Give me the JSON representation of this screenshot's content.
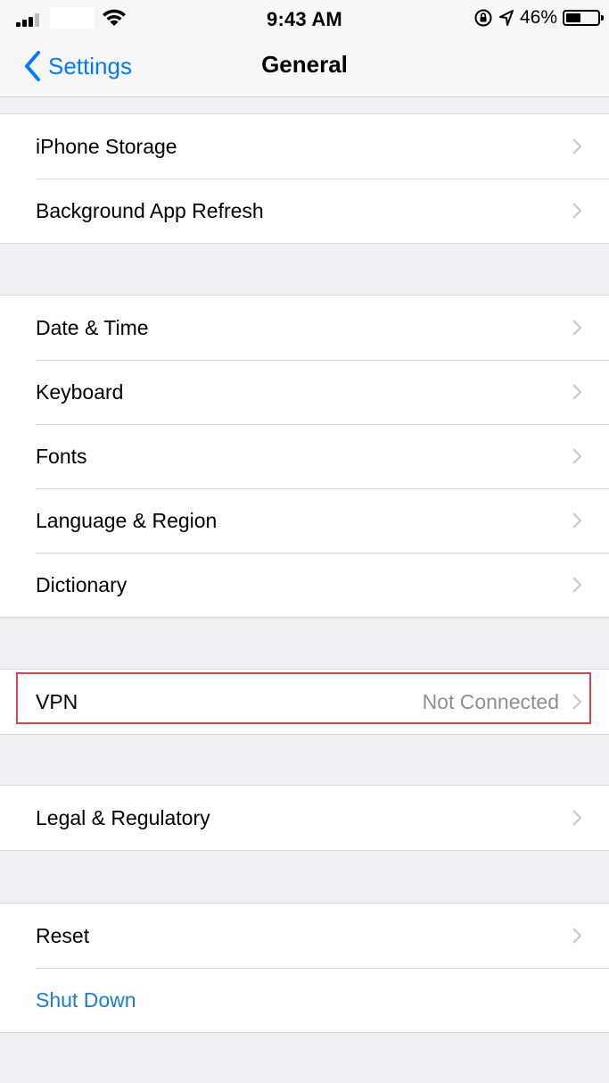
{
  "status_bar": {
    "time": "9:43 AM",
    "battery_percent": "46%",
    "battery_level": 0.46,
    "icons": [
      "signal-icon",
      "wifi-icon",
      "orientation-lock-icon",
      "location-icon",
      "battery-icon"
    ]
  },
  "nav": {
    "back_label": "Settings",
    "title": "General"
  },
  "groups": [
    {
      "items": [
        {
          "label": "iPhone Storage"
        },
        {
          "label": "Background App Refresh"
        }
      ]
    },
    {
      "items": [
        {
          "label": "Date & Time"
        },
        {
          "label": "Keyboard"
        },
        {
          "label": "Fonts"
        },
        {
          "label": "Language & Region"
        },
        {
          "label": "Dictionary"
        }
      ]
    },
    {
      "items": [
        {
          "label": "VPN",
          "value": "Not Connected"
        }
      ]
    },
    {
      "items": [
        {
          "label": "Legal & Regulatory"
        }
      ]
    },
    {
      "items": [
        {
          "label": "Reset"
        },
        {
          "label": "Shut Down"
        }
      ]
    }
  ],
  "colors": {
    "accent": "#007aff",
    "shut_down": "#1a7bd8",
    "highlight_box": "#d9454f",
    "background": "#efeff4"
  }
}
